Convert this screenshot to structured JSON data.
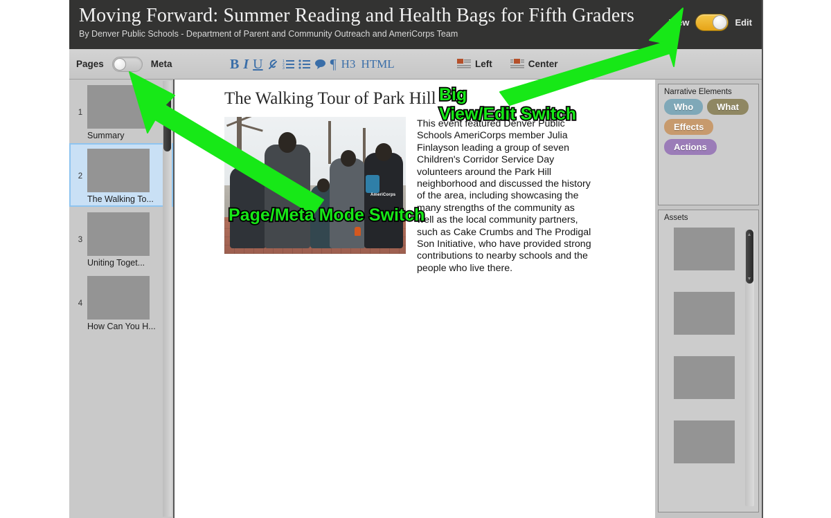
{
  "header": {
    "title": "Moving Forward: Summer Reading and Health Bags for Fifth Graders",
    "byline": "By Denver Public Schools - Department of Parent and Community Outreach and AmeriCorps Team",
    "view_label": "View",
    "edit_label": "Edit",
    "toggle_state": "Edit",
    "toggle_color": "#e6a417"
  },
  "toolbar": {
    "pages_label": "Pages",
    "meta_label": "Meta",
    "mode_toggle_state": "Pages",
    "format_buttons": [
      {
        "icon": "bold-icon",
        "label": "B"
      },
      {
        "icon": "italic-icon",
        "label": "I"
      },
      {
        "icon": "underline-icon",
        "label": "U"
      },
      {
        "icon": "link-icon",
        "label": "S"
      },
      {
        "icon": "ordered-list-icon",
        "label": ""
      },
      {
        "icon": "unordered-list-icon",
        "label": ""
      },
      {
        "icon": "comment-icon",
        "label": ""
      },
      {
        "icon": "pilcrow-icon",
        "label": "¶"
      },
      {
        "icon": "heading3-icon",
        "label": "H3"
      },
      {
        "icon": "html-icon",
        "label": "HTML"
      }
    ],
    "align_left_label": "Left",
    "align_center_label": "Center",
    "accent_color": "#3a6ea8"
  },
  "pages": {
    "items": [
      {
        "number": "1",
        "label": "Summary",
        "selected": false
      },
      {
        "number": "2",
        "label": "The Walking To...",
        "selected": true
      },
      {
        "number": "3",
        "label": "Uniting Toget...",
        "selected": false
      },
      {
        "number": "4",
        "label": "How Can You H...",
        "selected": false
      }
    ],
    "selected_highlight": "#c9e0f5"
  },
  "canvas": {
    "doc_title": "The Walking Tour of Park Hill",
    "photo_alt": "Group of walkers on a Park Hill sidewalk, one wearing an AmeriCorps jacket",
    "photo_badge_text": "AmeriCorps",
    "body_text": "This event featured Denver Public Schools AmeriCorps member Julia Finlayson leading a group of seven Children's Corridor Service Day volunteers around the Park Hill neighborhood and discussed the history of the area, including showcasing the many strengths of the community as well as the local community partners, such as Cake Crumbs and The Prodigal Son Initiative, who have provided strong contributions to nearby schools and the people who live there."
  },
  "right_panels": {
    "narrative": {
      "title": "Narrative Elements",
      "tags": [
        {
          "label": "Who",
          "color": "#7fa8b8"
        },
        {
          "label": "What",
          "color": "#8f8762"
        },
        {
          "label": "Effects",
          "color": "#c79a6d"
        },
        {
          "label": "Actions",
          "color": "#9b7cb8"
        }
      ]
    },
    "assets": {
      "title": "Assets",
      "thumbnail_count": 4
    }
  },
  "annotations": {
    "color": "#17e817",
    "items": [
      {
        "text": "Big\nView/Edit Switch",
        "target": "view-edit-switch"
      },
      {
        "text": "Page/Meta Mode Switch",
        "target": "pages-meta-switch"
      }
    ]
  }
}
